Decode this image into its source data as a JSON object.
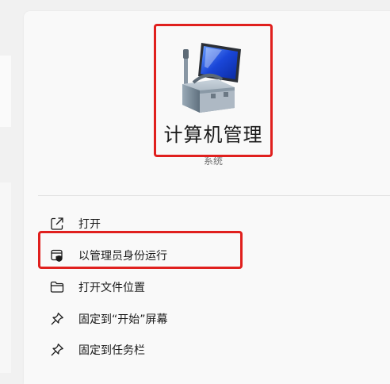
{
  "app": {
    "title": "计算机管理",
    "subtitle": "系统",
    "icon": "computer-management-icon"
  },
  "menu": {
    "items": [
      {
        "label": "打开",
        "icon": "open-external-icon"
      },
      {
        "label": "以管理员身份运行",
        "icon": "shield-admin-icon"
      },
      {
        "label": "打开文件位置",
        "icon": "folder-icon"
      },
      {
        "label": "固定到“开始”屏幕",
        "icon": "pin-icon"
      },
      {
        "label": "固定到任务栏",
        "icon": "pin-icon"
      }
    ]
  },
  "colors": {
    "highlight": "#e0201e",
    "panel_bg": "#f9f9f9",
    "text": "#1b1b1b",
    "subtext": "#6f6f6f"
  }
}
